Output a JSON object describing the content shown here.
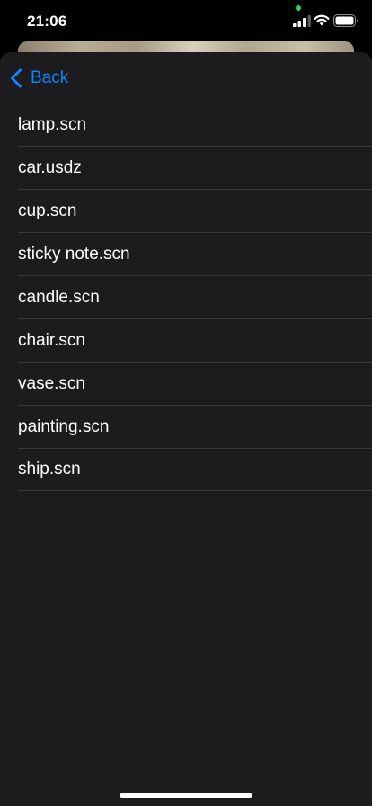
{
  "status_bar": {
    "time": "21:06",
    "privacy_dot_color": "#30d158"
  },
  "nav": {
    "back_label": "Back",
    "accent_color": "#0a84ff"
  },
  "files": [
    "lamp.scn",
    "car.usdz",
    "cup.scn",
    "sticky note.scn",
    "candle.scn",
    "chair.scn",
    "vase.scn",
    "painting.scn",
    "ship.scn"
  ]
}
